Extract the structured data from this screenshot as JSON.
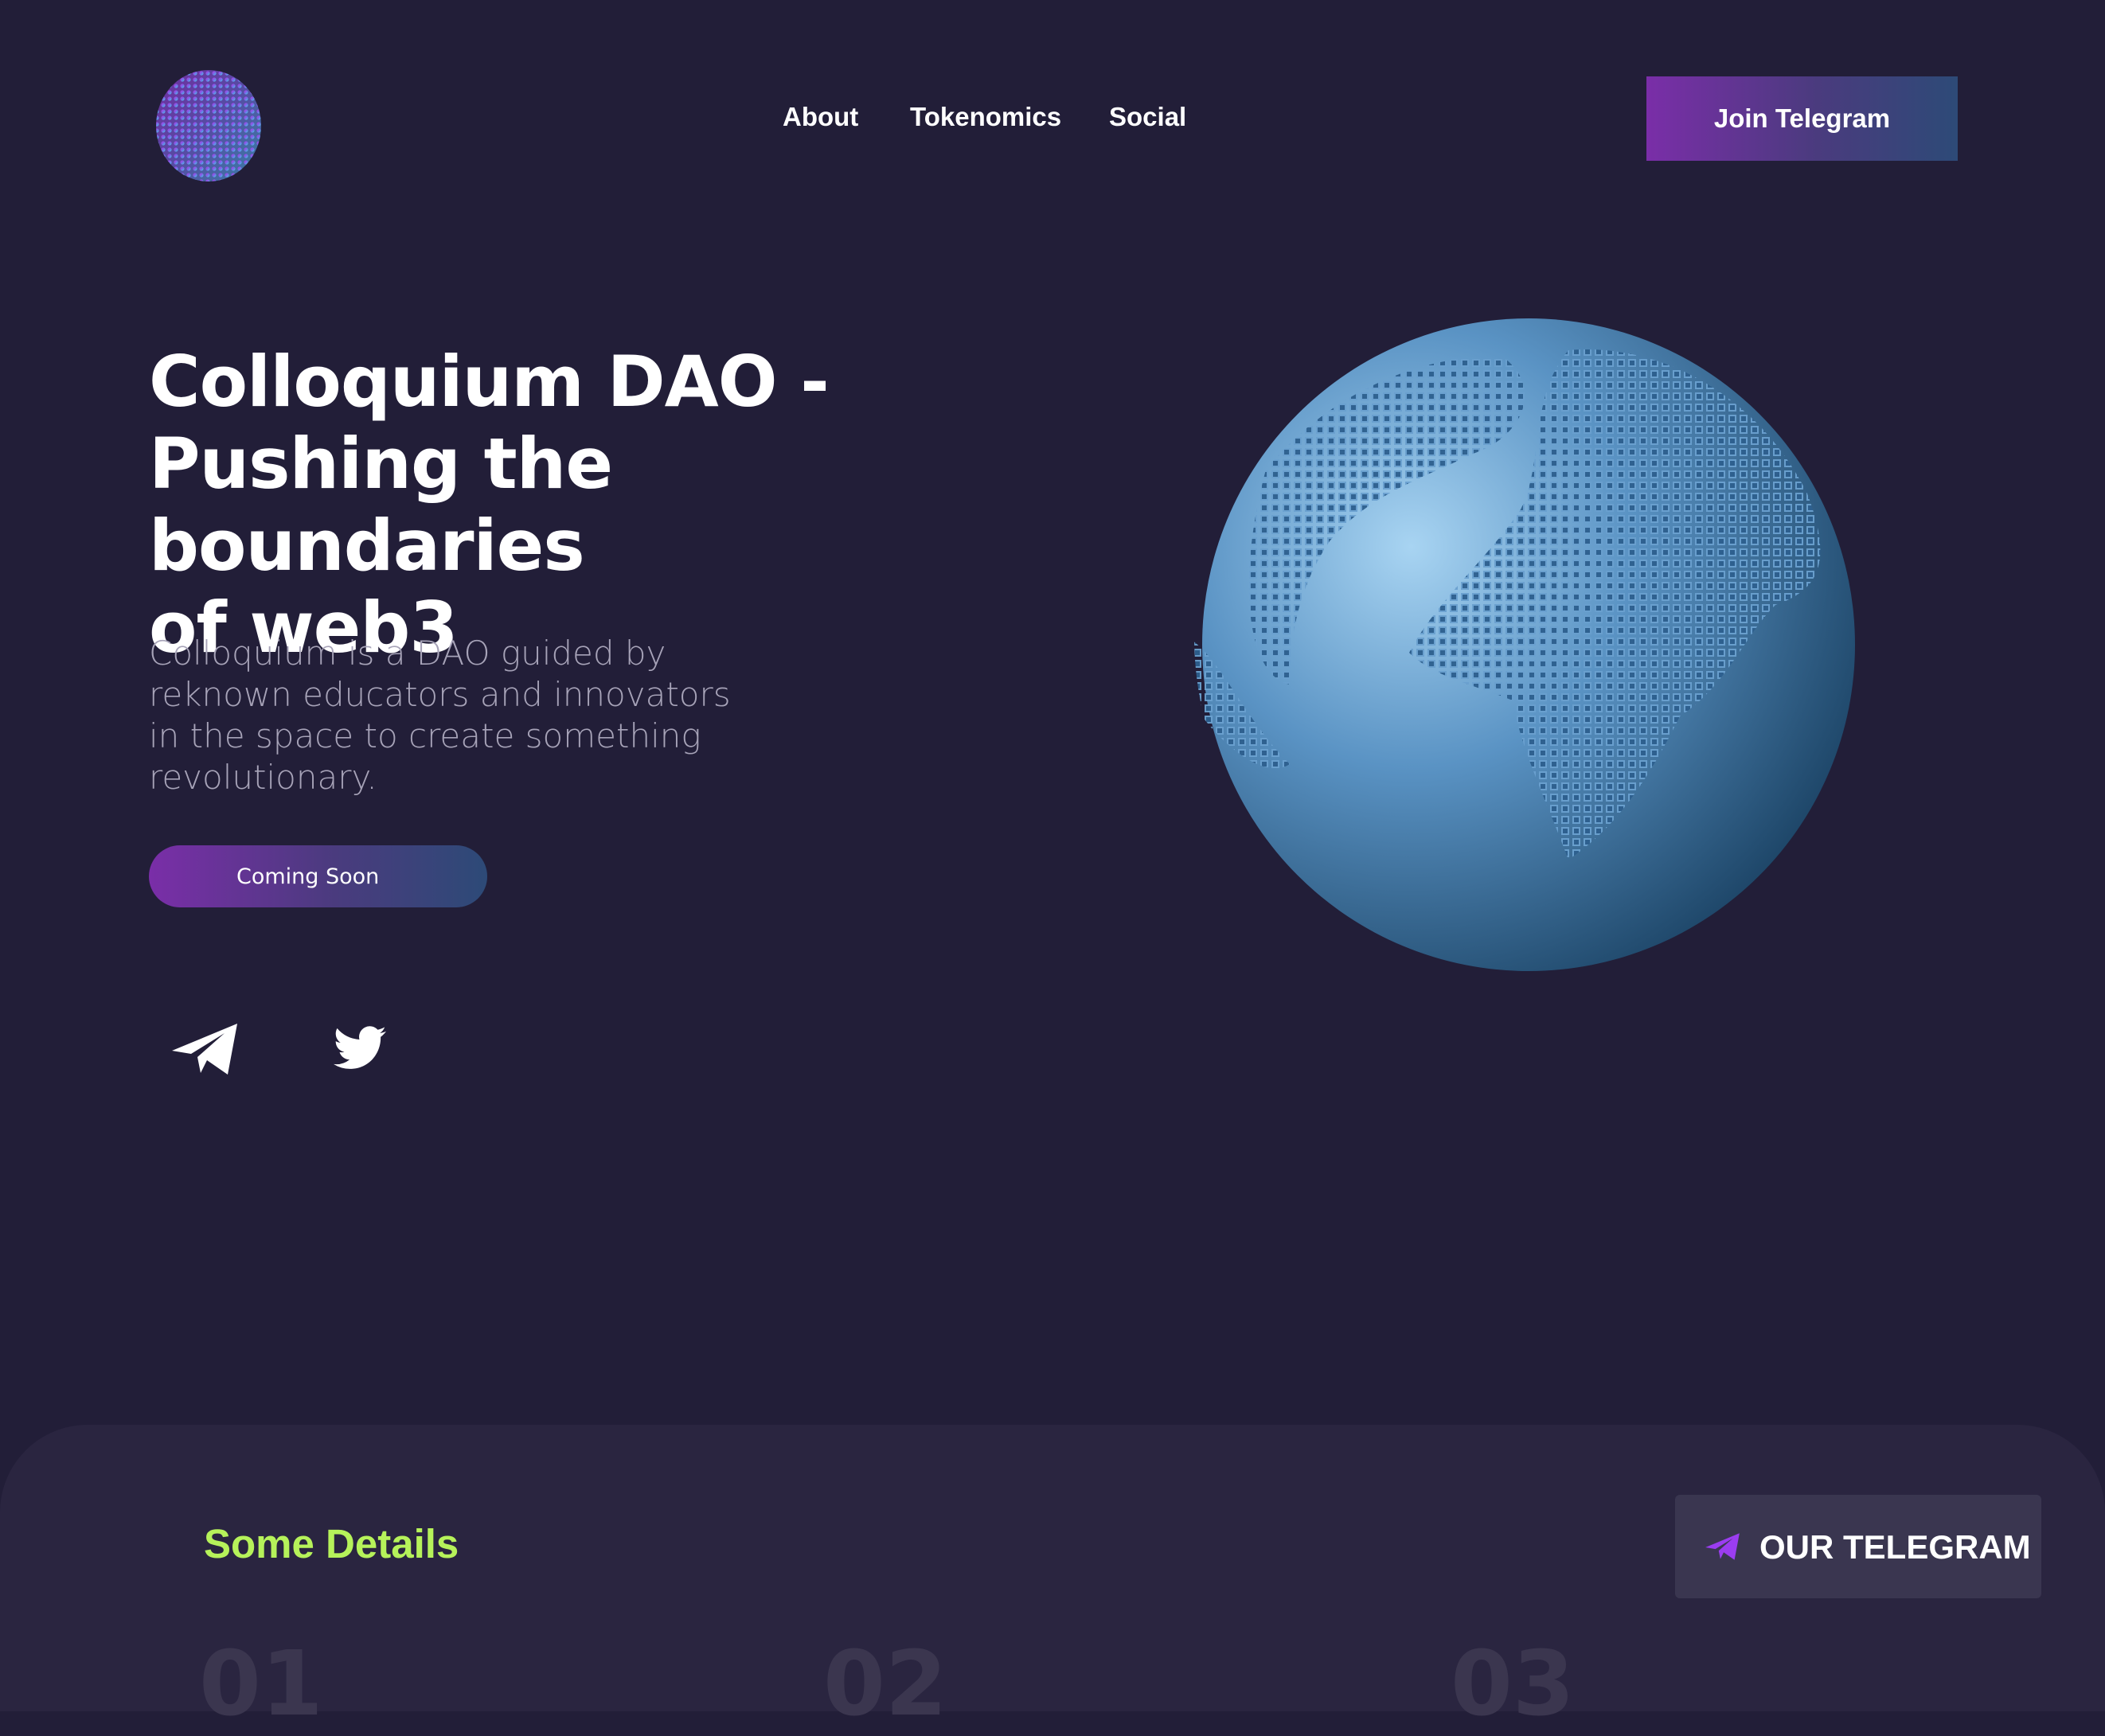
{
  "nav": {
    "links": [
      "About",
      "Tokenomics",
      "Social"
    ],
    "cta_label": "Join Telegram"
  },
  "hero": {
    "title_lines": [
      "Colloquium DAO -",
      "Pushing the boundaries",
      "of web3"
    ],
    "description": "Colloquium is a DAO guided by reknown educators and innovators in the space to create something revolutionary.",
    "button_label": "Coming Soon"
  },
  "social_icons": [
    "telegram-icon",
    "twitter-icon"
  ],
  "details": {
    "title": "Some Details",
    "button_label": "OUR TELEGRAM",
    "numbers": [
      "01",
      "02",
      "03"
    ]
  },
  "colors": {
    "background": "#221e38",
    "panel": "#2a2540",
    "accent_green": "#b6f25a",
    "gradient_start": "#7a2ea8",
    "gradient_end": "#2d4a77",
    "telegram_purple": "#9b3df0"
  }
}
